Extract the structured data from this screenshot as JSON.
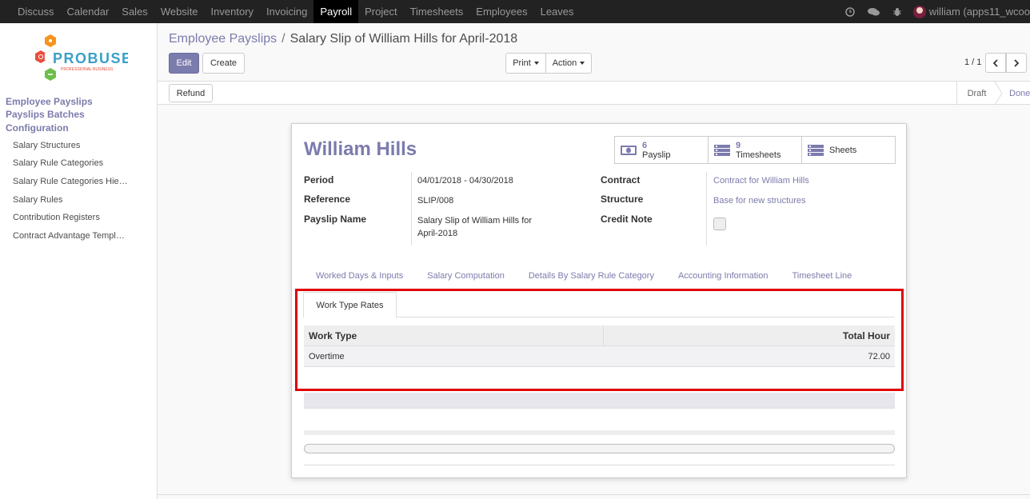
{
  "topbar": {
    "menu": [
      "Discuss",
      "Calendar",
      "Sales",
      "Website",
      "Inventory",
      "Invoicing",
      "Payroll",
      "Project",
      "Timesheets",
      "Employees",
      "Leaves"
    ],
    "active": "Payroll",
    "user": "william (apps11_wcoo"
  },
  "sidebar": {
    "logo_text": "PROBUSE",
    "logo_sub": "PROFESSIONAL BUSINESS",
    "heads": [
      "Employee Payslips",
      "Payslips Batches",
      "Configuration"
    ],
    "config_items": [
      "Salary Structures",
      "Salary Rule Categories",
      "Salary Rule Categories Hie…",
      "Salary Rules",
      "Contribution Registers",
      "Contract Advantage Templ…"
    ]
  },
  "control_panel": {
    "breadcrumb_parent": "Employee Payslips",
    "breadcrumb_sep": "/",
    "breadcrumb_current": "Salary Slip of William Hills for April-2018",
    "edit_label": "Edit",
    "create_label": "Create",
    "print_label": "Print",
    "action_label": "Action",
    "pager": "1 / 1"
  },
  "statusbar": {
    "refund_label": "Refund",
    "states": [
      "Draft",
      "Done"
    ]
  },
  "form": {
    "employee_name": "William Hills",
    "smart_buttons": [
      {
        "count": "6",
        "label": "Payslip",
        "icon": "money-icon"
      },
      {
        "count": "9",
        "label": "Timesheets",
        "icon": "list-icon"
      },
      {
        "count": "",
        "label": "Sheets",
        "icon": "list-icon"
      }
    ],
    "period_label": "Period",
    "period_value": "04/01/2018 - 04/30/2018",
    "reference_label": "Reference",
    "reference_value": "SLIP/008",
    "payslip_name_label": "Payslip Name",
    "payslip_name_value_line1": "Salary Slip of William Hills for",
    "payslip_name_value_line2": "April-2018",
    "contract_label": "Contract",
    "contract_value": "Contract for William Hills",
    "structure_label": "Structure",
    "structure_value": "Base for new structures",
    "credit_note_label": "Credit Note",
    "tabs": [
      "Worked Days & Inputs",
      "Salary Computation",
      "Details By Salary Rule Category",
      "Accounting Information",
      "Timesheet Line"
    ],
    "subtab": "Work Type Rates",
    "table": {
      "headers": [
        "Work Type",
        "Total Hour"
      ],
      "rows": [
        {
          "work_type": "Overtime",
          "total_hour": "72.00"
        }
      ]
    }
  },
  "colors": {
    "brand": "#7c7bad",
    "highlight": "#e00000",
    "topbar": "#222222"
  }
}
